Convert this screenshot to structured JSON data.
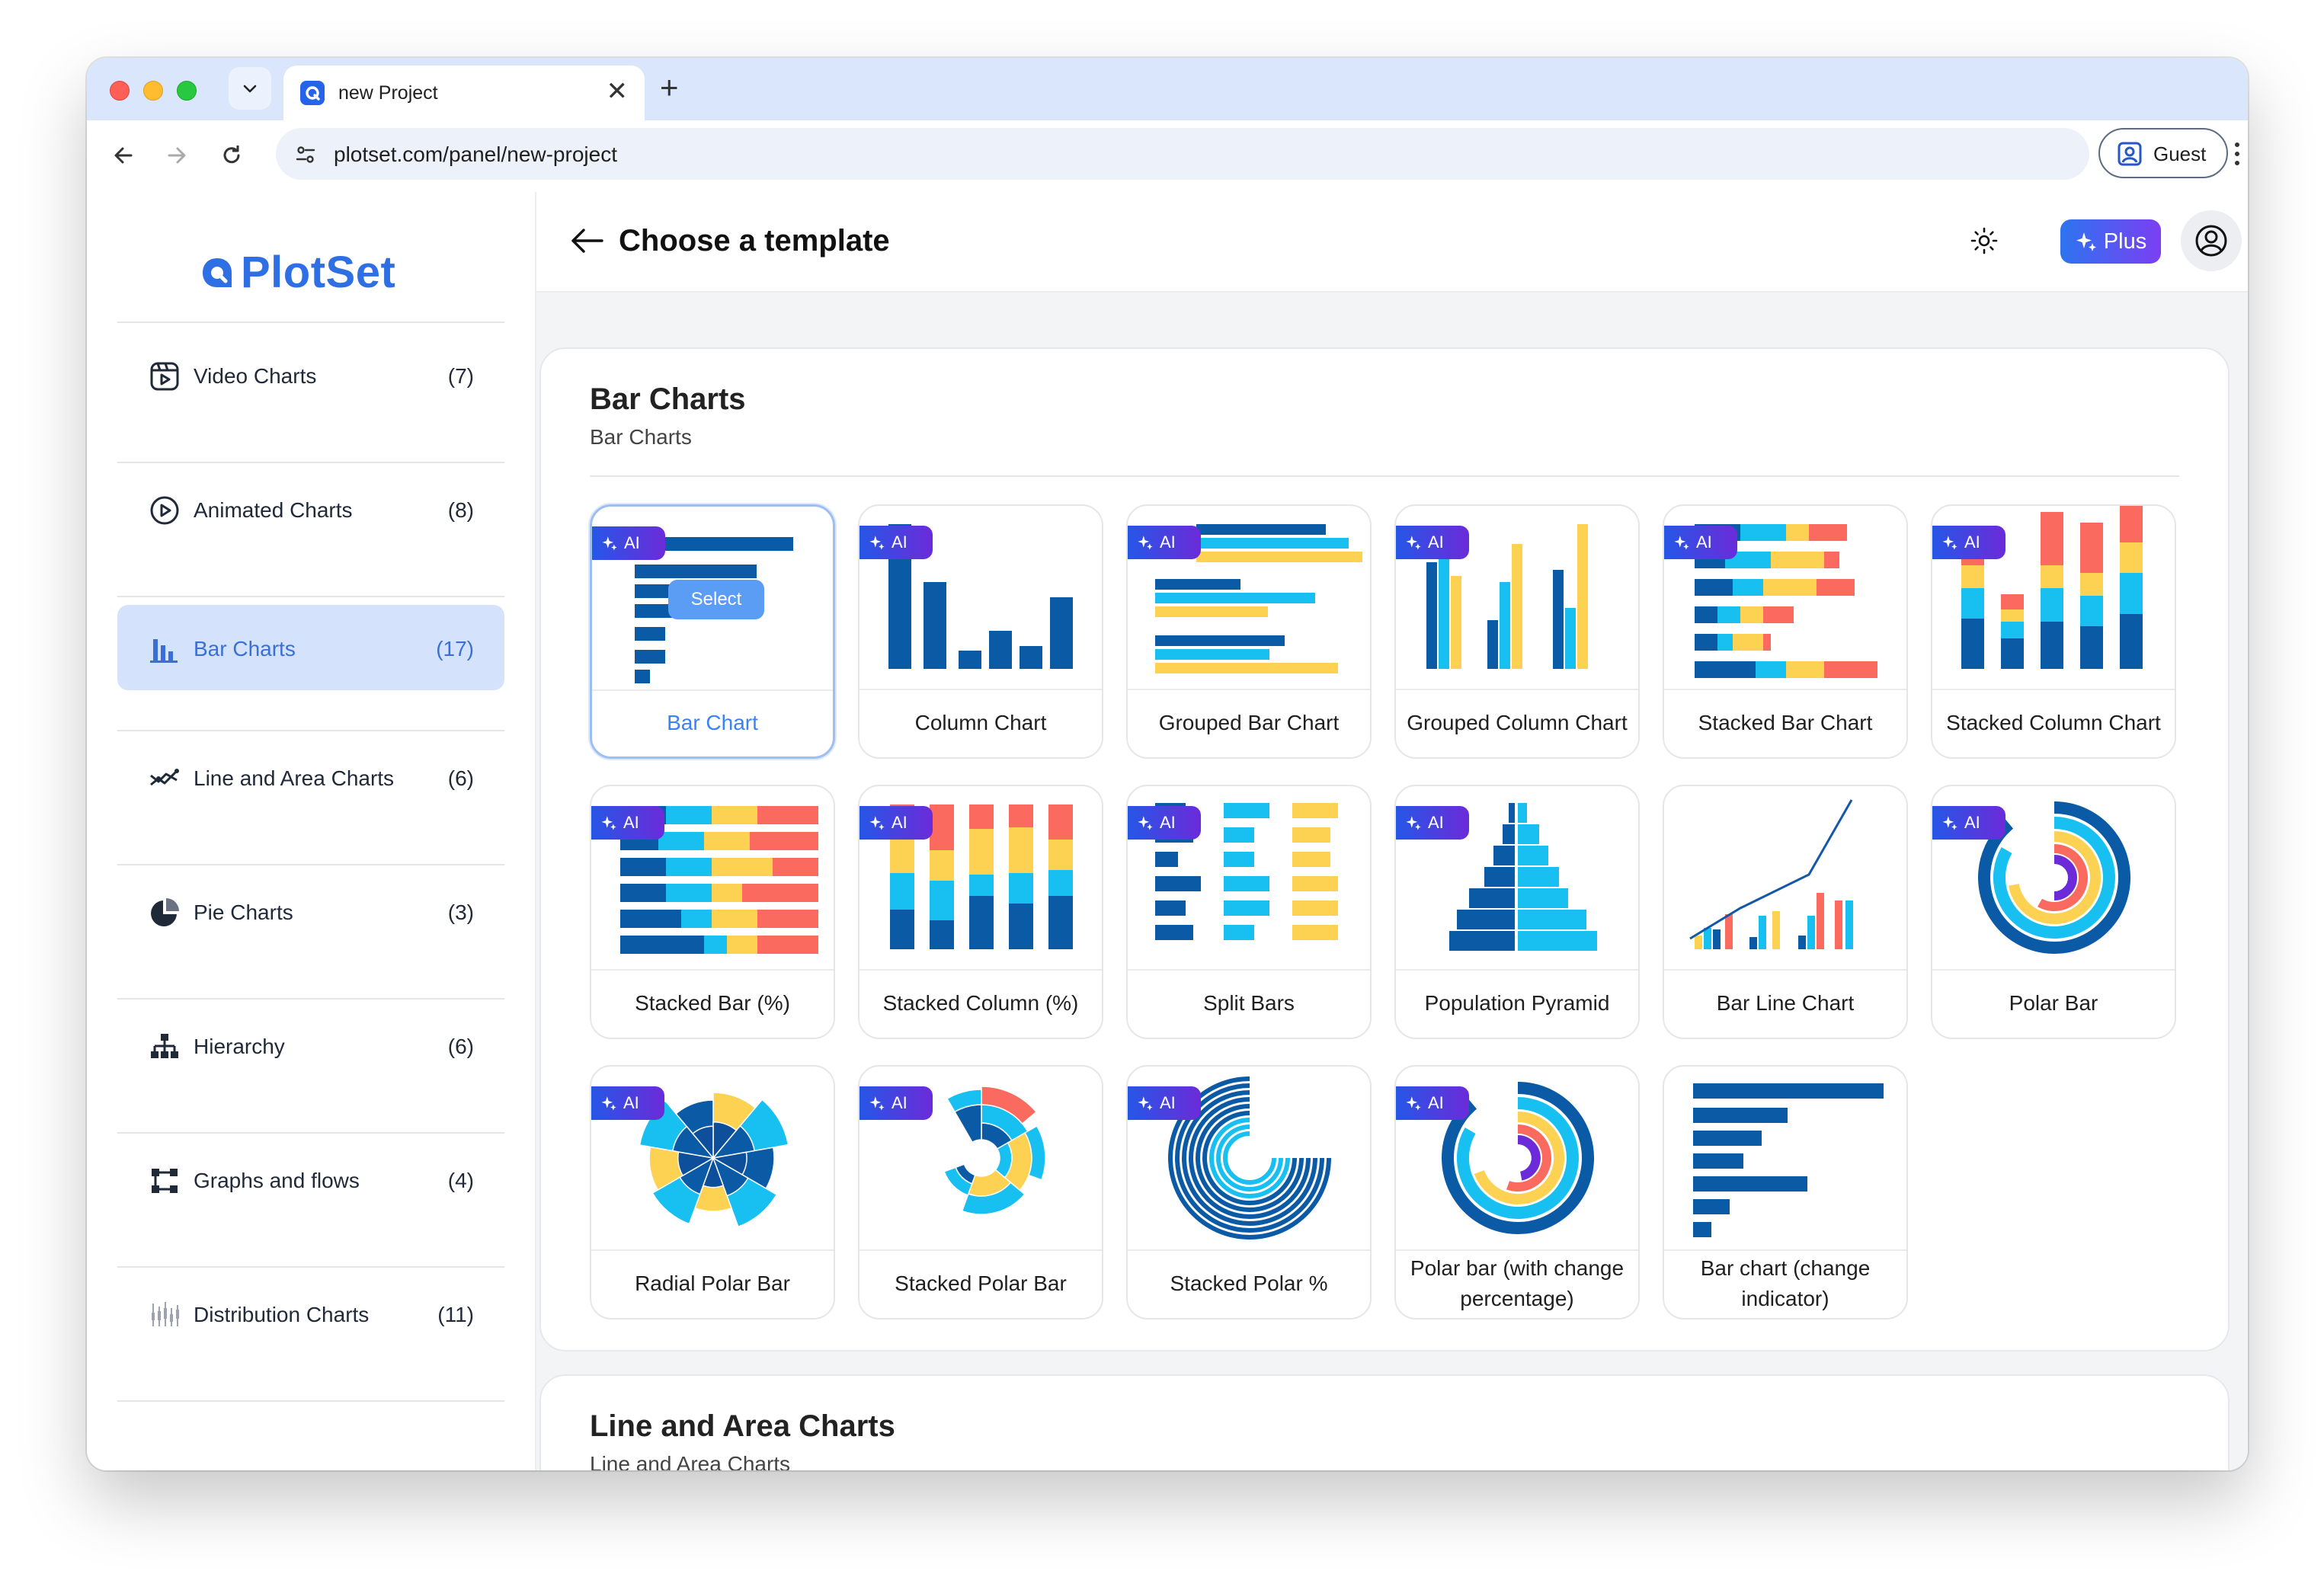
{
  "browser": {
    "tab_title": "new Project",
    "tab_close": "✕",
    "new_tab": "+",
    "url": "plotset.com/panel/new-project",
    "profile_label": "Guest"
  },
  "sidebar": {
    "logo_text": "PlotSet",
    "items": [
      {
        "label": "Video Charts",
        "count": "(7)",
        "icon": "video-icon",
        "active": false
      },
      {
        "label": "Animated Charts",
        "count": "(8)",
        "icon": "play-circle-icon",
        "active": false
      },
      {
        "label": "Bar Charts",
        "count": "(17)",
        "icon": "bar-chart-icon",
        "active": true
      },
      {
        "label": "Line and Area Charts",
        "count": "(6)",
        "icon": "line-chart-icon",
        "active": false
      },
      {
        "label": "Pie Charts",
        "count": "(3)",
        "icon": "pie-chart-icon",
        "active": false
      },
      {
        "label": "Hierarchy",
        "count": "(6)",
        "icon": "hierarchy-icon",
        "active": false
      },
      {
        "label": "Graphs and flows",
        "count": "(4)",
        "icon": "graph-flow-icon",
        "active": false
      },
      {
        "label": "Distribution Charts",
        "count": "(11)",
        "icon": "distribution-icon",
        "active": false
      }
    ]
  },
  "header": {
    "title": "Choose a template",
    "plus_label": "Plus"
  },
  "sections": [
    {
      "title": "Bar Charts",
      "subtitle": "Bar Charts",
      "cards": [
        {
          "label": "Bar Chart",
          "ai": true,
          "selected": true,
          "thumb": "bar"
        },
        {
          "label": "Column Chart",
          "ai": true,
          "thumb": "column"
        },
        {
          "label": "Grouped Bar Chart",
          "ai": true,
          "thumb": "grouped-bar"
        },
        {
          "label": "Grouped Column Chart",
          "ai": true,
          "thumb": "grouped-column"
        },
        {
          "label": "Stacked Bar Chart",
          "ai": true,
          "thumb": "stacked-bar"
        },
        {
          "label": "Stacked Column Chart",
          "ai": true,
          "thumb": "stacked-column"
        },
        {
          "label": "Stacked Bar (%)",
          "ai": true,
          "thumb": "stacked-bar-pct"
        },
        {
          "label": "Stacked Column (%)",
          "ai": true,
          "thumb": "stacked-column-pct"
        },
        {
          "label": "Split Bars",
          "ai": true,
          "thumb": "split-bars"
        },
        {
          "label": "Population Pyramid",
          "ai": true,
          "thumb": "pyramid"
        },
        {
          "label": "Bar Line Chart",
          "ai": false,
          "thumb": "bar-line"
        },
        {
          "label": "Polar Bar",
          "ai": true,
          "thumb": "polar-bar"
        },
        {
          "label": "Radial Polar Bar",
          "ai": true,
          "thumb": "radial-polar"
        },
        {
          "label": "Stacked Polar Bar",
          "ai": true,
          "thumb": "stacked-polar"
        },
        {
          "label": "Stacked Polar %",
          "ai": true,
          "thumb": "stacked-polar-pct"
        },
        {
          "label": "Polar bar (with change percentage)",
          "ai": true,
          "thumb": "polar-change"
        },
        {
          "label": "Bar chart (change indicator)",
          "ai": false,
          "thumb": "bar-change"
        }
      ]
    },
    {
      "title": "Line and Area Charts",
      "subtitle": "Line and Area Charts"
    }
  ],
  "card_ui": {
    "ai_badge": "AI",
    "select_label": "Select"
  },
  "colors": {
    "navy": "#0b5aa6",
    "cyan": "#18c0f2",
    "yellow": "#fdd253",
    "coral": "#fb6a5f",
    "purple": "#6c2bd9",
    "accent": "#2f6fe4"
  }
}
